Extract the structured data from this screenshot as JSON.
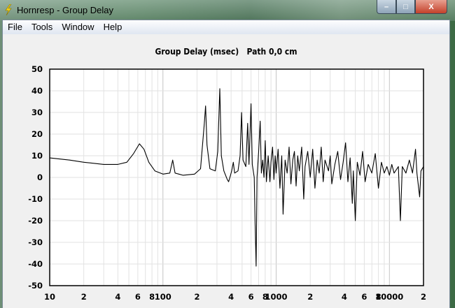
{
  "window": {
    "title": "Hornresp - Group Delay",
    "minimize": "–",
    "maximize": "□",
    "close": "X"
  },
  "menu": [
    {
      "label": "File"
    },
    {
      "label": "Tools"
    },
    {
      "label": "Window"
    },
    {
      "label": "Help"
    }
  ],
  "chart_data": {
    "type": "line",
    "title": "Group Delay (msec)   Path 0,0 cm",
    "xscale": "log",
    "xlim": [
      10,
      20000
    ],
    "ylim": [
      -50,
      50
    ],
    "yticks": [
      50,
      40,
      30,
      20,
      10,
      0,
      -10,
      -20,
      -30,
      -40,
      -50
    ],
    "xtick_values": [
      10,
      20,
      40,
      60,
      80,
      100,
      200,
      400,
      600,
      800,
      1000,
      2000,
      4000,
      6000,
      8000,
      10000,
      20000
    ],
    "xtick_labels": [
      "10",
      "2",
      "4",
      "6",
      "8",
      "100",
      "2",
      "4",
      "6",
      "8",
      "1000",
      "2",
      "4",
      "6",
      "8",
      "10000",
      "2"
    ],
    "grid": true,
    "series": [
      {
        "name": "Group Delay",
        "color": "#000000",
        "points": [
          [
            10,
            9
          ],
          [
            15,
            8
          ],
          [
            20,
            7
          ],
          [
            30,
            6
          ],
          [
            40,
            6
          ],
          [
            48,
            7
          ],
          [
            55,
            11
          ],
          [
            62,
            15.5
          ],
          [
            68,
            13
          ],
          [
            75,
            7
          ],
          [
            85,
            3
          ],
          [
            100,
            1.5
          ],
          [
            115,
            2
          ],
          [
            122,
            8
          ],
          [
            128,
            2
          ],
          [
            150,
            1
          ],
          [
            190,
            1.5
          ],
          [
            215,
            4
          ],
          [
            232,
            25
          ],
          [
            238,
            33
          ],
          [
            245,
            15
          ],
          [
            260,
            4
          ],
          [
            290,
            3
          ],
          [
            305,
            12
          ],
          [
            318,
            41
          ],
          [
            328,
            10
          ],
          [
            345,
            3
          ],
          [
            370,
            -1
          ],
          [
            380,
            -2
          ],
          [
            395,
            1
          ],
          [
            405,
            3
          ],
          [
            418,
            7
          ],
          [
            430,
            2
          ],
          [
            460,
            3
          ],
          [
            480,
            10
          ],
          [
            495,
            30
          ],
          [
            510,
            8
          ],
          [
            540,
            5
          ],
          [
            560,
            25
          ],
          [
            575,
            6
          ],
          [
            600,
            34
          ],
          [
            615,
            6
          ],
          [
            640,
            0
          ],
          [
            652,
            -22
          ],
          [
            665,
            -41
          ],
          [
            678,
            0
          ],
          [
            700,
            12
          ],
          [
            722,
            26
          ],
          [
            740,
            2
          ],
          [
            760,
            8
          ],
          [
            780,
            0
          ],
          [
            800,
            17
          ],
          [
            820,
            -2
          ],
          [
            850,
            10
          ],
          [
            880,
            -2
          ],
          [
            900,
            7
          ],
          [
            930,
            14
          ],
          [
            955,
            -1
          ],
          [
            980,
            10
          ],
          [
            1000,
            2
          ],
          [
            1040,
            13
          ],
          [
            1080,
            -5
          ],
          [
            1120,
            10
          ],
          [
            1150,
            -17
          ],
          [
            1200,
            8
          ],
          [
            1250,
            2
          ],
          [
            1300,
            14
          ],
          [
            1350,
            -3
          ],
          [
            1400,
            8
          ],
          [
            1450,
            12
          ],
          [
            1500,
            -4
          ],
          [
            1550,
            10
          ],
          [
            1600,
            3
          ],
          [
            1680,
            14
          ],
          [
            1750,
            -10
          ],
          [
            1800,
            5
          ],
          [
            1900,
            12
          ],
          [
            2000,
            0
          ],
          [
            2100,
            13
          ],
          [
            2200,
            -5
          ],
          [
            2300,
            8
          ],
          [
            2400,
            2
          ],
          [
            2500,
            14
          ],
          [
            2600,
            -2
          ],
          [
            2700,
            8
          ],
          [
            2900,
            3
          ],
          [
            3000,
            10
          ],
          [
            3100,
            -3
          ],
          [
            3300,
            6
          ],
          [
            3500,
            12
          ],
          [
            3700,
            -1
          ],
          [
            3900,
            7
          ],
          [
            4100,
            16
          ],
          [
            4300,
            -2
          ],
          [
            4500,
            9
          ],
          [
            4700,
            -12
          ],
          [
            4800,
            3
          ],
          [
            5000,
            -20
          ],
          [
            5200,
            7
          ],
          [
            5500,
            1
          ],
          [
            5800,
            12
          ],
          [
            6100,
            -2
          ],
          [
            6500,
            6
          ],
          [
            7000,
            2
          ],
          [
            7500,
            11
          ],
          [
            8000,
            -5
          ],
          [
            8500,
            7
          ],
          [
            9000,
            2
          ],
          [
            9500,
            5
          ],
          [
            10000,
            1
          ],
          [
            10500,
            6
          ],
          [
            11000,
            2
          ],
          [
            12000,
            5
          ],
          [
            12500,
            -20
          ],
          [
            13000,
            5
          ],
          [
            14000,
            2
          ],
          [
            15000,
            8
          ],
          [
            16000,
            2
          ],
          [
            17000,
            13
          ],
          [
            17500,
            2
          ],
          [
            18500,
            -9
          ],
          [
            19000,
            3
          ],
          [
            20000,
            5
          ]
        ]
      }
    ]
  }
}
